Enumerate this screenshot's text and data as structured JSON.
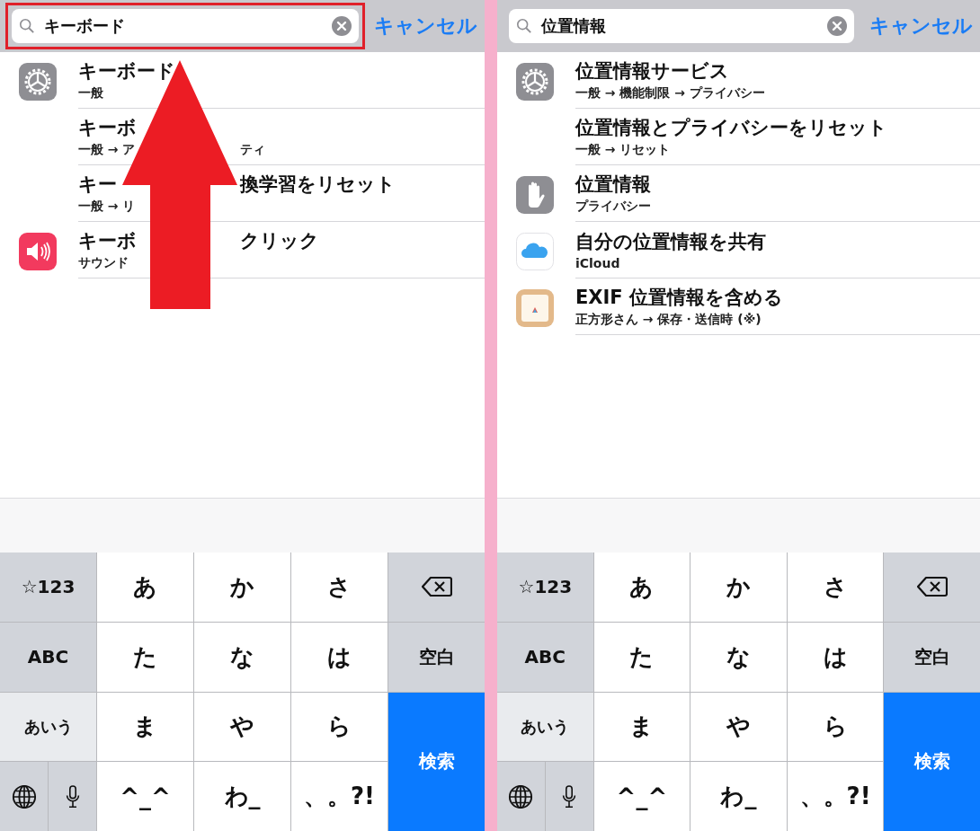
{
  "panels": [
    {
      "search": {
        "value": "キーボード",
        "highlighted": true
      },
      "cancel": "キャンセル",
      "arrow": true,
      "results": [
        {
          "kind": "settings",
          "title_parts": [
            "キーボード"
          ],
          "path_parts": [
            "一般"
          ]
        },
        {
          "kind": "plain",
          "title_parts": [
            "キーボ"
          ],
          "path_parts": [
            "一般 → ア",
            "ティ"
          ]
        },
        {
          "kind": "plain",
          "title_parts": [
            "キー",
            "換学習をリセット"
          ],
          "path_parts": [
            "一般 → リ"
          ]
        },
        {
          "kind": "sound",
          "title_parts": [
            "キーボ",
            "クリック"
          ],
          "path_parts": [
            "サウンド"
          ]
        }
      ],
      "keys": [
        {
          "label": "☆123",
          "kind": "function"
        },
        {
          "label": "あ",
          "kind": "letter"
        },
        {
          "label": "か",
          "kind": "letter"
        },
        {
          "label": "さ",
          "kind": "letter"
        },
        {
          "kind": "delete"
        },
        {
          "label": "ABC",
          "kind": "function"
        },
        {
          "label": "た",
          "kind": "letter"
        },
        {
          "label": "な",
          "kind": "letter"
        },
        {
          "label": "は",
          "kind": "letter"
        },
        {
          "label": "空白",
          "kind": "function"
        },
        {
          "label": "あいう",
          "kind": "mode"
        },
        {
          "label": "ま",
          "kind": "letter"
        },
        {
          "label": "や",
          "kind": "letter"
        },
        {
          "label": "ら",
          "kind": "letter"
        },
        {
          "label": "検索",
          "kind": "return"
        },
        {
          "kind": "globe"
        },
        {
          "kind": "mic"
        },
        {
          "label": "^_^",
          "kind": "letter"
        },
        {
          "label": "わ_",
          "kind": "letter"
        },
        {
          "label": "、。?!",
          "kind": "letter"
        }
      ]
    },
    {
      "search": {
        "value": "位置情報",
        "highlighted": false
      },
      "cancel": "キャンセル",
      "arrow": false,
      "results": [
        {
          "kind": "settings",
          "title_parts": [
            "位置情報サービス"
          ],
          "path_parts": [
            "一般 → 機能制限 → プライバシー"
          ]
        },
        {
          "kind": "plain",
          "title_parts": [
            "位置情報とプライバシーをリセット"
          ],
          "path_parts": [
            "一般 → リセット"
          ]
        },
        {
          "kind": "privacy",
          "title_parts": [
            "位置情報"
          ],
          "path_parts": [
            "プライバシー"
          ]
        },
        {
          "kind": "icloud",
          "title_parts": [
            "自分の位置情報を共有"
          ],
          "path_parts": [
            "iCloud"
          ]
        },
        {
          "kind": "app",
          "title_parts": [
            "EXIF 位置情報を含める"
          ],
          "path_parts": [
            "正方形さん → 保存・送信時 (※)"
          ]
        }
      ],
      "keys": [
        {
          "label": "☆123",
          "kind": "function"
        },
        {
          "label": "あ",
          "kind": "letter"
        },
        {
          "label": "か",
          "kind": "letter"
        },
        {
          "label": "さ",
          "kind": "letter"
        },
        {
          "kind": "delete"
        },
        {
          "label": "ABC",
          "kind": "function"
        },
        {
          "label": "た",
          "kind": "letter"
        },
        {
          "label": "な",
          "kind": "letter"
        },
        {
          "label": "は",
          "kind": "letter"
        },
        {
          "label": "空白",
          "kind": "function"
        },
        {
          "label": "あいう",
          "kind": "mode"
        },
        {
          "label": "ま",
          "kind": "letter"
        },
        {
          "label": "や",
          "kind": "letter"
        },
        {
          "label": "ら",
          "kind": "letter"
        },
        {
          "label": "検索",
          "kind": "return"
        },
        {
          "kind": "globe"
        },
        {
          "kind": "mic"
        },
        {
          "label": "^_^",
          "kind": "letter"
        },
        {
          "label": "わ_",
          "kind": "letter"
        },
        {
          "label": "、。?!",
          "kind": "letter"
        }
      ]
    }
  ]
}
